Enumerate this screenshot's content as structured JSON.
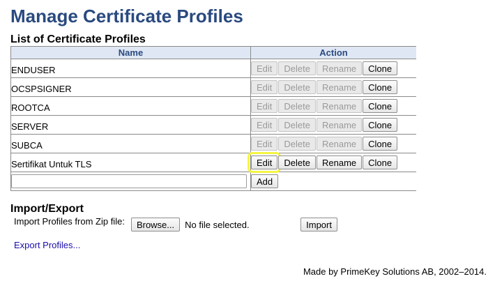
{
  "page_title": "Manage Certificate Profiles",
  "list_title": "List of Certificate Profiles",
  "table": {
    "headers": {
      "name": "Name",
      "action": "Action"
    },
    "rows": [
      {
        "name": "ENDUSER",
        "actions_enabled": false
      },
      {
        "name": "OCSPSIGNER",
        "actions_enabled": false
      },
      {
        "name": "ROOTCA",
        "actions_enabled": false
      },
      {
        "name": "SERVER",
        "actions_enabled": false
      },
      {
        "name": "SUBCA",
        "actions_enabled": false
      },
      {
        "name": "Sertifikat Untuk TLS",
        "actions_enabled": true
      }
    ],
    "buttons": {
      "edit": "Edit",
      "delete": "Delete",
      "rename": "Rename",
      "clone": "Clone"
    },
    "add": {
      "value": "",
      "button": "Add"
    }
  },
  "import_export": {
    "title": "Import/Export",
    "import_label": "Import Profiles from Zip file:",
    "browse_button": "Browse...",
    "file_status": "No file selected.",
    "import_button": "Import",
    "export_link": "Export Profiles..."
  },
  "footer": "Made by PrimeKey Solutions AB, 2002–2014.",
  "colors": {
    "title": "#2a4a7f",
    "header_bg": "#dfe7f4",
    "highlight": "#f5f542",
    "link": "#1a0dab"
  }
}
